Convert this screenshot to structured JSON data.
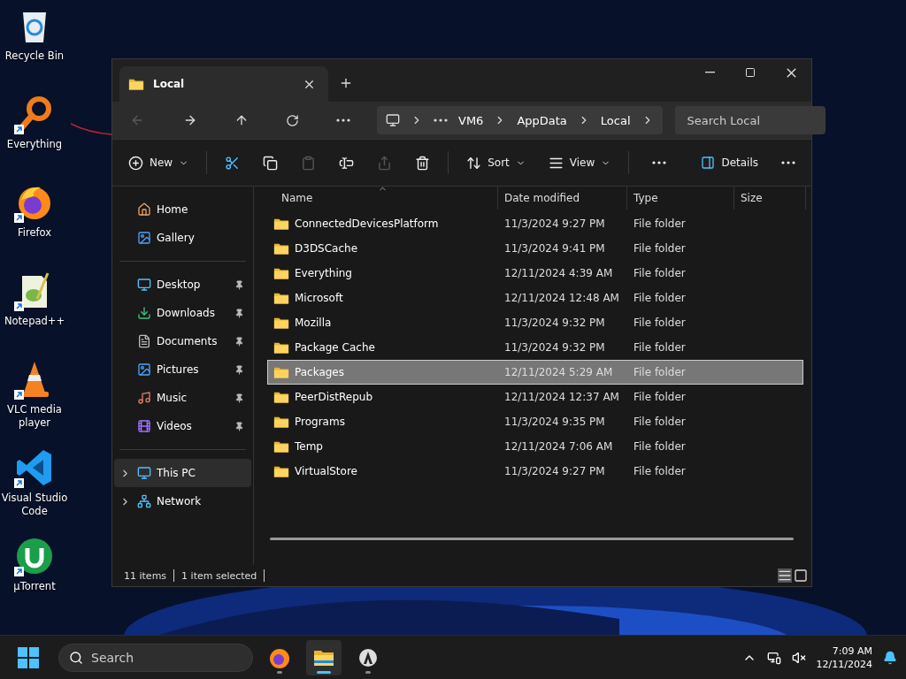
{
  "desktop_icons": [
    {
      "label": "Recycle Bin",
      "kind": "recycle",
      "shortcut": false
    },
    {
      "label": "Everything",
      "kind": "everything",
      "shortcut": true
    },
    {
      "label": "Firefox",
      "kind": "firefox",
      "shortcut": true
    },
    {
      "label": "Notepad++",
      "kind": "notepad",
      "shortcut": true
    },
    {
      "label": "VLC media player",
      "kind": "vlc",
      "shortcut": true
    },
    {
      "label": "Visual Studio Code",
      "kind": "vscode",
      "shortcut": true
    },
    {
      "label": "µTorrent",
      "kind": "utorrent",
      "shortcut": true
    }
  ],
  "window": {
    "tabs": [
      {
        "title": "Local",
        "selected": true
      }
    ],
    "address": {
      "segments": [
        "VM6",
        "AppData",
        "Local"
      ]
    },
    "search": {
      "placeholder": "Search Local"
    },
    "toolbar": [
      {
        "kind": "new",
        "label": "New",
        "disabled": false
      },
      {
        "kind": "cut",
        "disabled": false
      },
      {
        "kind": "copy",
        "disabled": false
      },
      {
        "kind": "paste",
        "disabled": true
      },
      {
        "kind": "rename",
        "disabled": false
      },
      {
        "kind": "share",
        "disabled": true
      },
      {
        "kind": "delete",
        "disabled": false
      },
      {
        "kind": "sort",
        "label": "Sort",
        "disabled": false
      },
      {
        "kind": "view",
        "label": "View",
        "disabled": false
      },
      {
        "kind": "more",
        "disabled": false
      }
    ],
    "details_button": "Details",
    "sidebar": {
      "sections": [
        [
          {
            "label": "Home",
            "kind": "home",
            "pinned": false,
            "expandable": false,
            "selected": false
          },
          {
            "label": "Gallery",
            "kind": "gallery",
            "pinned": false,
            "expandable": false,
            "selected": false
          }
        ],
        [
          {
            "label": "Desktop",
            "kind": "desktop",
            "pinned": true,
            "expandable": false,
            "selected": false
          },
          {
            "label": "Downloads",
            "kind": "downloads",
            "pinned": true,
            "expandable": false,
            "selected": false
          },
          {
            "label": "Documents",
            "kind": "documents",
            "pinned": true,
            "expandable": false,
            "selected": false
          },
          {
            "label": "Pictures",
            "kind": "pictures",
            "pinned": true,
            "expandable": false,
            "selected": false
          },
          {
            "label": "Music",
            "kind": "music",
            "pinned": true,
            "expandable": false,
            "selected": false
          },
          {
            "label": "Videos",
            "kind": "videos",
            "pinned": true,
            "expandable": false,
            "selected": false
          }
        ],
        [
          {
            "label": "This PC",
            "kind": "pc",
            "pinned": false,
            "expandable": true,
            "selected": true
          },
          {
            "label": "Network",
            "kind": "network",
            "pinned": false,
            "expandable": true,
            "selected": false
          }
        ]
      ]
    },
    "table": {
      "columns": [
        "Name",
        "Date modified",
        "Type",
        "Size"
      ],
      "rows": [
        {
          "name": "ConnectedDevicesPlatform",
          "date": "11/3/2024 9:27 PM",
          "type": "File folder",
          "selected": false
        },
        {
          "name": "D3DSCache",
          "date": "11/3/2024 9:41 PM",
          "type": "File folder",
          "selected": false
        },
        {
          "name": "Everything",
          "date": "12/11/2024 4:39 AM",
          "type": "File folder",
          "selected": false
        },
        {
          "name": "Microsoft",
          "date": "12/11/2024 12:48 AM",
          "type": "File folder",
          "selected": false
        },
        {
          "name": "Mozilla",
          "date": "11/3/2024 9:32 PM",
          "type": "File folder",
          "selected": false
        },
        {
          "name": "Package Cache",
          "date": "11/3/2024 9:32 PM",
          "type": "File folder",
          "selected": false
        },
        {
          "name": "Packages",
          "date": "12/11/2024 5:29 AM",
          "type": "File folder",
          "selected": true
        },
        {
          "name": "PeerDistRepub",
          "date": "12/11/2024 12:37 AM",
          "type": "File folder",
          "selected": false
        },
        {
          "name": "Programs",
          "date": "11/3/2024 9:35 PM",
          "type": "File folder",
          "selected": false
        },
        {
          "name": "Temp",
          "date": "12/11/2024 7:06 AM",
          "type": "File folder",
          "selected": false
        },
        {
          "name": "VirtualStore",
          "date": "11/3/2024 9:27 PM",
          "type": "File folder",
          "selected": false
        }
      ]
    },
    "status_bar": {
      "count": "11 items",
      "selection": "1 item selected"
    }
  },
  "taskbar": {
    "search": {
      "placeholder": "Search"
    },
    "apps": [
      {
        "kind": "firefox",
        "active": false
      },
      {
        "kind": "explorer",
        "active": true
      },
      {
        "kind": "inkscape",
        "active": false
      }
    ],
    "time": "7:09 AM",
    "date": "12/11/2024"
  }
}
